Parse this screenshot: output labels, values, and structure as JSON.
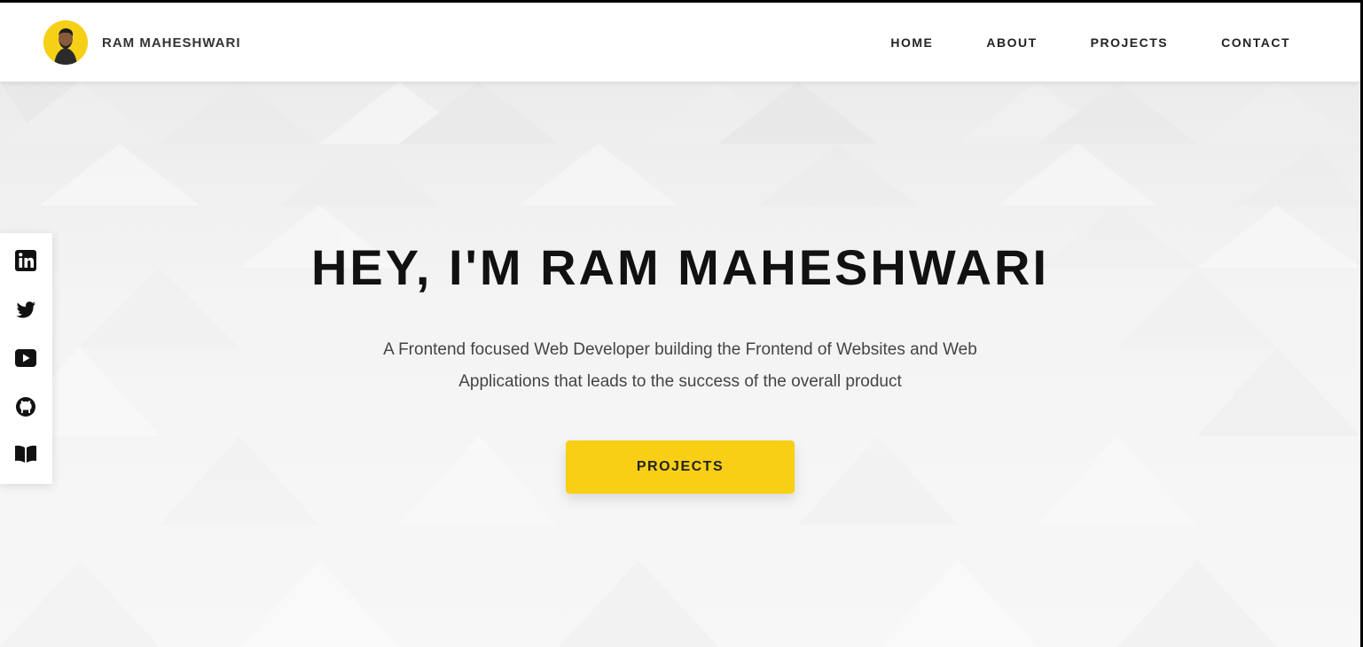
{
  "header": {
    "brand_name": "RAM MAHESHWARI",
    "nav": [
      "HOME",
      "ABOUT",
      "PROJECTS",
      "CONTACT"
    ]
  },
  "hero": {
    "title": "HEY, I'M RAM MAHESHWARI",
    "description": "A Frontend focused Web Developer building the Frontend of Websites and Web Applications that leads to the success of the overall product",
    "button_label": "PROJECTS"
  },
  "social": [
    "linkedin-icon",
    "twitter-icon",
    "youtube-icon",
    "github-icon",
    "book-icon"
  ],
  "colors": {
    "accent": "#f8cf15",
    "text_dark": "#111111",
    "text_body": "#444444",
    "background": "#f6f6f6"
  }
}
